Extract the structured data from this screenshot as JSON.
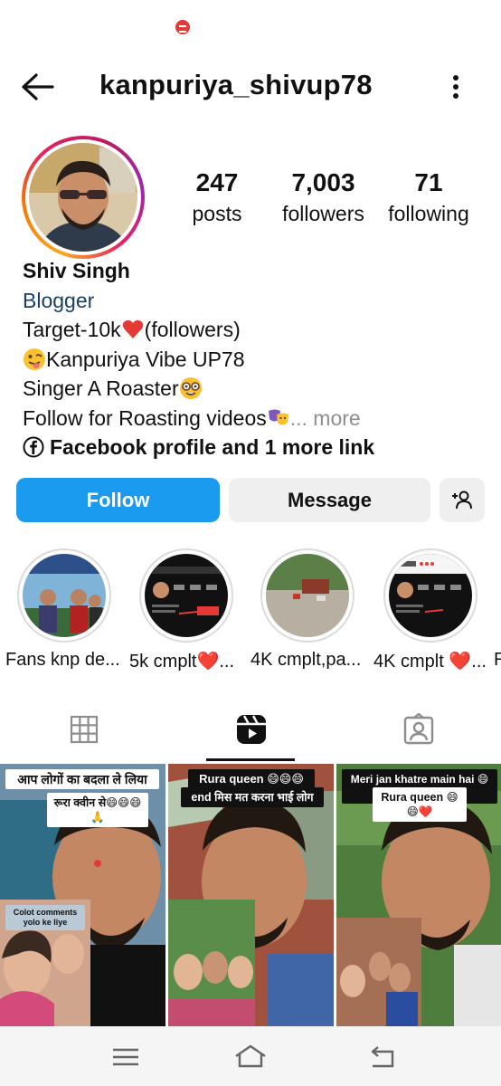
{
  "header": {
    "username": "kanpuriya_shivup78"
  },
  "stats": [
    {
      "value": "247",
      "label": "posts"
    },
    {
      "value": "7,003",
      "label": "followers"
    },
    {
      "value": "71",
      "label": "following"
    }
  ],
  "bio": {
    "name": "Shiv Singh",
    "category": "Blogger",
    "line1": "Target-10k",
    "line1_suffix": "(followers)",
    "line2": "Kanpuriya Vibe  UP78",
    "line3": "Singer A Roaster",
    "line4": "Follow for Roasting videos",
    "more": "... more",
    "links": "Facebook profile and 1 more link"
  },
  "actions": {
    "follow": "Follow",
    "message": "Message"
  },
  "highlights": [
    {
      "label": "Fans knp de..."
    },
    {
      "label": "5k cmplt❤️..."
    },
    {
      "label": "4K cmplt,pa..."
    },
    {
      "label": "4K cmplt ❤️..."
    },
    {
      "label": "R"
    }
  ],
  "reels": [
    {
      "caption1": "आप लोगों का बदला ले लिया",
      "caption2": "रूरा क्वीन से😄😄😄🙏",
      "caption3": "Colot comments yolo ke liye"
    },
    {
      "caption1": "Rura queen 😄😄😄",
      "caption2": "end मिस मत करना भाई लोग"
    },
    {
      "caption1": "Meri jan khatre main hai 😄😄🙏",
      "caption2": "Rura queen 😄😄❤️"
    }
  ],
  "colors": {
    "follow_blue": "#1a9bf0",
    "category_blue": "#1c3f66",
    "heart_red": "#e53935"
  },
  "icons": [
    "back-arrow-icon",
    "more-vertical-icon",
    "facebook-icon",
    "add-person-icon",
    "grid-icon",
    "reels-icon",
    "tagged-icon",
    "menu-icon",
    "home-icon",
    "back-icon"
  ]
}
